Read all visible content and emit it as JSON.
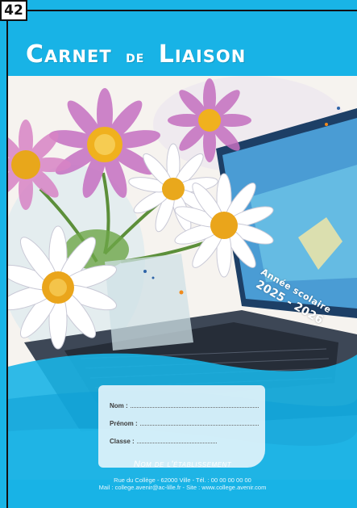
{
  "page": {
    "number": "42"
  },
  "cover": {
    "title_part1": "Carnet",
    "title_part2": "de",
    "title_part3": "Liaison",
    "school_year_label": "Année scolaire",
    "school_year": "2025 - 2026"
  },
  "form": {
    "name_label": "Nom :",
    "firstname_label": "Prénom :",
    "class_label": "Classe :"
  },
  "school": {
    "name": "Nom de l'établissement",
    "address": "Rue du Collège - 62000 Ville - Tél. : 00 00 00 00 00",
    "contact": "Mail : college.avenir@ac-lille.fr - Site : www.college.avenir.com"
  },
  "colors": {
    "background": "#19b4e6",
    "title": "#ffffff",
    "form_box": "#ebf6fc"
  },
  "illustration": {
    "description_icons": [
      "daisy-flower-icon",
      "laptop-icon"
    ]
  }
}
